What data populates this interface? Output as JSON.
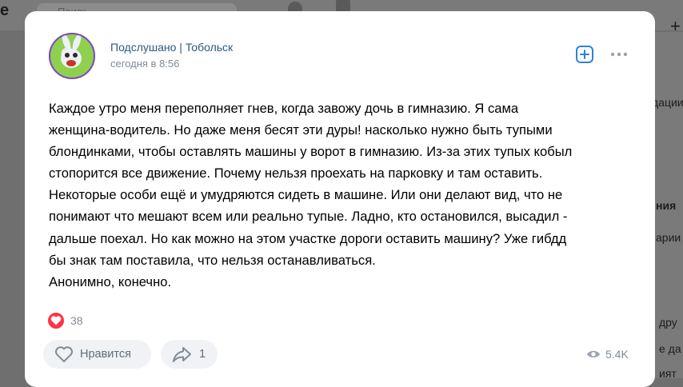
{
  "background": {
    "logo_fragment": "е",
    "search_placeholder": "Поиск",
    "right_fragments": [
      "дации",
      "ния",
      "арии",
      "дру",
      "е да",
      "ият"
    ]
  },
  "post": {
    "group_name": "Подслушано | Тобольск",
    "timestamp": "сегодня в 8:56",
    "text": "Каждое утро меня переполняет гнев, когда завожу дочь в гимназию. Я сама\nженщина-водитель. Но даже меня бесят эти дуры! насколько нужно быть тупыми\nблондинками, чтобы оставлять машины у ворот в гимназию. Из-за этих тупых кобыл\nстопорится все движение. Почему нельзя проехать на парковку и там оставить.\nНекоторые особи ещё и умудряются сидеть в машине. Или они делают вид, что не\nпонимают что мешают всем или реально тупые. Ладно, кто остановился, высадил -\nдальше поехал. Но как можно на этом участке дороги оставить машину? Уже гибдд\nбы знак там поставила, что нельзя останавливаться.\nАнонимно, конечно.",
    "likes_count": "38",
    "like_label": "Нравится",
    "share_count": "1",
    "views_count": "5.4K"
  },
  "colors": {
    "link": "#2a5885",
    "secondary_text": "#818c99",
    "like_red": "#ff3347",
    "button_bg": "#f0f2f5"
  },
  "icons": [
    "search-icon",
    "bell-icon",
    "music-icon",
    "add-square-icon",
    "more-horizontal-icon",
    "heart-icon",
    "share-icon",
    "eye-icon"
  ]
}
